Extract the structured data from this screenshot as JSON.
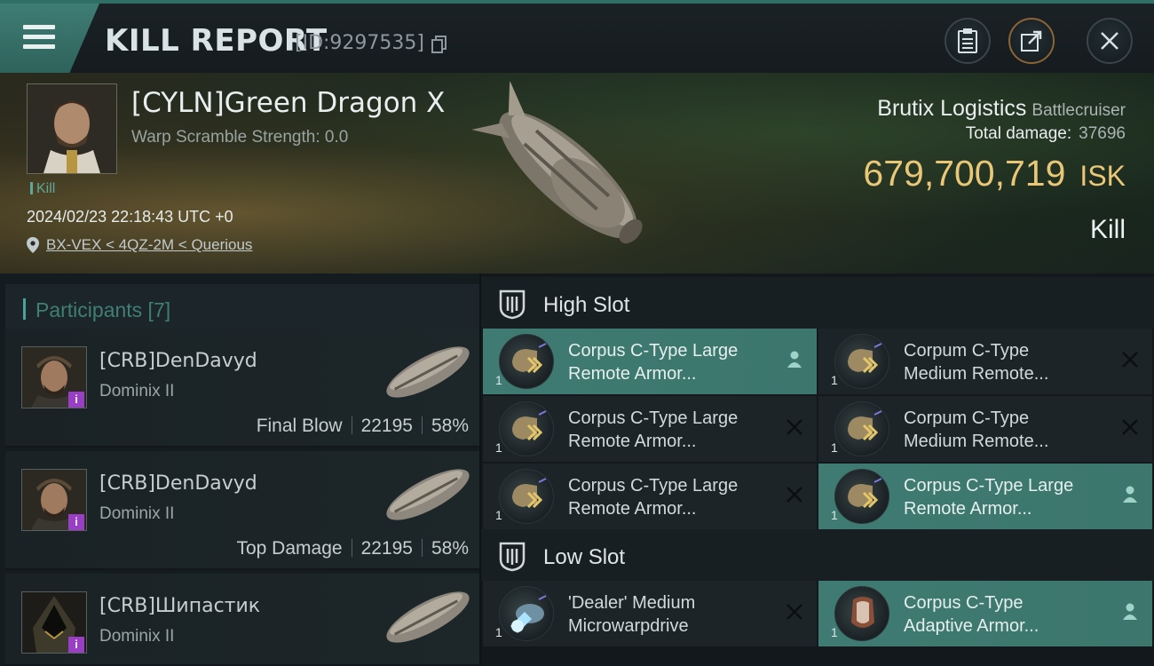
{
  "header": {
    "title": "KILL REPORT",
    "report_id": "[ID:9297535]"
  },
  "victim": {
    "name": "[CYLN]Green Dragon X",
    "warp_scramble": "Warp Scramble Strength: 0.0",
    "tag": "Kill",
    "timestamp": "2024/02/23 22:18:43 UTC +0",
    "location": "BX-VEX < 4QZ-2M < Querious",
    "ship_name": "Brutix Logistics",
    "ship_class": "Battlecruiser",
    "total_damage_label": "Total damage:",
    "total_damage": "37696",
    "isk_value": "679,700,719",
    "isk_unit": "ISK",
    "result": "Kill"
  },
  "participants": {
    "title": "Participants [7]",
    "rows": [
      {
        "name": "[CRB]DenDavyd",
        "ship": "Dominix II",
        "role": "Final Blow",
        "damage": "22195",
        "percent": "58%",
        "badge": "i"
      },
      {
        "name": "[CRB]DenDavyd",
        "ship": "Dominix II",
        "role": "Top Damage",
        "damage": "22195",
        "percent": "58%",
        "badge": "i"
      },
      {
        "name": "[CRB]Шипастик",
        "ship": "Dominix II",
        "role": "",
        "damage": "",
        "percent": "",
        "badge": "i"
      }
    ]
  },
  "slots": {
    "high_title": "High Slot",
    "low_title": "Low Slot",
    "high_items": [
      {
        "line1": "Corpus C-Type Large",
        "line2": "Remote Armor...",
        "qty": "1",
        "state": "dropped"
      },
      {
        "line1": "Corpum C-Type",
        "line2": "Medium Remote...",
        "qty": "1",
        "state": "destroyed"
      },
      {
        "line1": "Corpus C-Type Large",
        "line2": "Remote Armor...",
        "qty": "1",
        "state": "destroyed"
      },
      {
        "line1": "Corpum C-Type",
        "line2": "Medium Remote...",
        "qty": "1",
        "state": "destroyed"
      },
      {
        "line1": "Corpus C-Type Large",
        "line2": "Remote Armor...",
        "qty": "1",
        "state": "destroyed"
      },
      {
        "line1": "Corpus C-Type Large",
        "line2": "Remote Armor...",
        "qty": "1",
        "state": "dropped"
      }
    ],
    "low_items": [
      {
        "line1": "'Dealer' Medium",
        "line2": "Microwarpdrive",
        "qty": "1",
        "state": "destroyed"
      },
      {
        "line1": "Corpus C-Type",
        "line2": "Adaptive Armor...",
        "qty": "1",
        "state": "dropped"
      }
    ]
  },
  "colors": {
    "accent": "#3f7b72",
    "isk": "#e9c777",
    "badge": "#9b3ec7"
  }
}
